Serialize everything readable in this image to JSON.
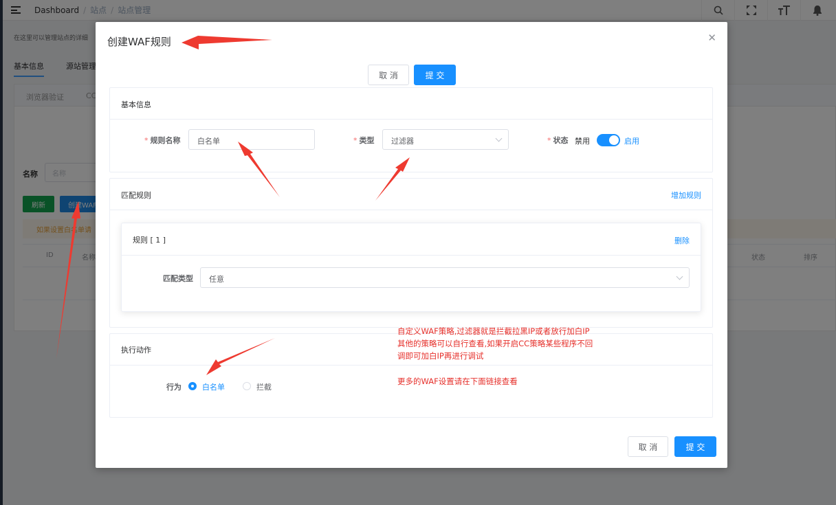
{
  "breadcrumb": [
    "Dashboard",
    "站点",
    "站点管理"
  ],
  "background": {
    "description": "在这里可以管理站点的详细",
    "tabs": [
      "基本信息",
      "源站管理"
    ],
    "subtabs": [
      "浏览器验证",
      "CC"
    ],
    "name_label": "名称",
    "name_placeholder": "名称",
    "refresh_button": "刷新",
    "create_button": "创建WAF",
    "warning_text": "如果设置白名单请",
    "table_columns": {
      "id": "ID",
      "name": "名称",
      "status": "状态",
      "sort": "排序"
    }
  },
  "dialog": {
    "title": "创建WAF规则",
    "cancel_label": "取 消",
    "submit_label": "提 交",
    "basic_section": {
      "title": "基本信息",
      "rule_name_label": "规则名称",
      "rule_name_value": "白名单",
      "type_label": "类型",
      "type_value": "过滤器",
      "status_label": "状态",
      "status_off": "禁用",
      "status_on": "启用"
    },
    "match_section": {
      "title": "匹配规则",
      "add_rule": "增加规则",
      "rule_title": "规则 [ 1 ]",
      "delete": "删除",
      "match_type_label": "匹配类型",
      "match_type_value": "任意"
    },
    "action_section": {
      "title": "执行动作",
      "behavior_label": "行为",
      "option_whitelist": "白名单",
      "option_block": "拦截"
    }
  },
  "annotations": {
    "line1": "自定义WAF策略,过滤器就是拦截拉黑IP或者放行加白IP",
    "line2": "其他的策略可以自行查看,如果开启CC策略某些程序不回",
    "line3": "调即可加白IP再进行调试",
    "line4": "更多的WAF设置请在下面链接查看"
  },
  "colors": {
    "primary": "#1890ff",
    "annotation": "#e6302b",
    "required": "#f56c6c"
  }
}
